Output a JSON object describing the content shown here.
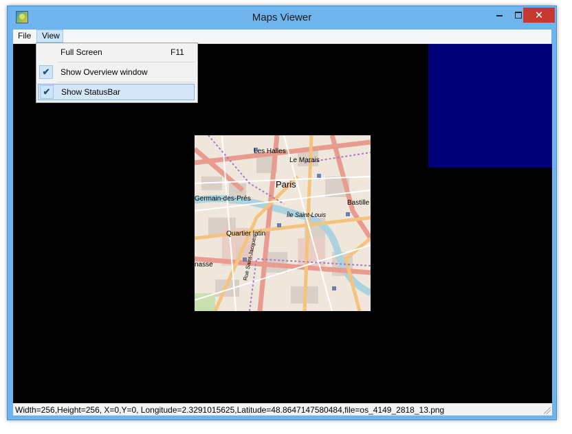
{
  "window": {
    "title": "Maps Viewer",
    "close_glyph": "✕",
    "icons": [
      "app-icon",
      "minimize-icon",
      "maximize-icon",
      "close-icon"
    ]
  },
  "menubar": {
    "file_label": "File",
    "view_label": "View"
  },
  "view_menu": {
    "items": [
      {
        "label": "Full Screen",
        "shortcut": "F11",
        "checked": false
      },
      {
        "label": "Show Overview window",
        "checked": true,
        "check_glyph": "✔"
      },
      {
        "label": "Show StatusBar",
        "checked": true,
        "check_glyph": "✔",
        "highlighted": true
      }
    ]
  },
  "map": {
    "labels": [
      "Les Halles",
      "Le Marais",
      "Paris",
      "Germain-des-Prés",
      "Bastille",
      "Île Saint-Louis",
      "Quartier latin",
      "nasse",
      "Rue Saint-Jacques"
    ],
    "overview_color": "#000078"
  },
  "statusbar": {
    "text": "Width=256,Height=256, X=0,Y=0, Longitude=2.3291015625,Latitude=48.8647147580484,file=os_4149_2818_13.png"
  }
}
